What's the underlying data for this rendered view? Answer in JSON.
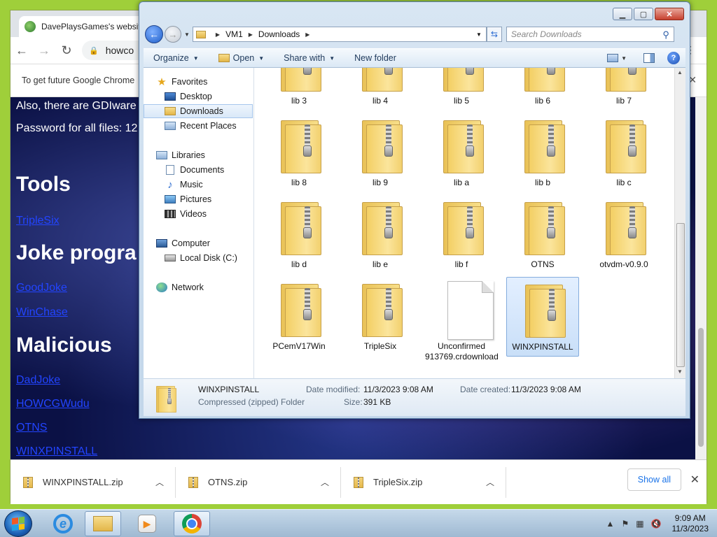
{
  "browser": {
    "tab_title": "DavePlaysGames's website",
    "url": "howco",
    "infobar_text": "To get future Google Chrome",
    "page": {
      "line1": "Also, there are GDIware",
      "password_line": "Password for all files: 12",
      "tools_heading": "Tools",
      "tools_link": "TripleSix",
      "joke_heading": "Joke progra",
      "joke_links": [
        "GoodJoke",
        "WinChase"
      ],
      "malicious_heading": "Malicious",
      "malicious_links": [
        "DadJoke",
        "HOWCGWudu",
        "OTNS",
        "WINXPINSTALL"
      ]
    },
    "downloads": [
      {
        "name": "WINXPINSTALL.zip"
      },
      {
        "name": "OTNS.zip"
      },
      {
        "name": "TripleSix.zip"
      }
    ],
    "show_all_label": "Show all"
  },
  "explorer": {
    "breadcrumb": [
      "VM1",
      "Downloads"
    ],
    "search_placeholder": "Search Downloads",
    "commands": {
      "organize": "Organize",
      "open": "Open",
      "share_with": "Share with",
      "new_folder": "New folder"
    },
    "nav": {
      "favorites": "Favorites",
      "desktop": "Desktop",
      "downloads": "Downloads",
      "recent_places": "Recent Places",
      "libraries": "Libraries",
      "documents": "Documents",
      "music": "Music",
      "pictures": "Pictures",
      "videos": "Videos",
      "computer": "Computer",
      "local_disk": "Local Disk (C:)",
      "network": "Network"
    },
    "files": [
      {
        "name": "lib 3",
        "type": "zip"
      },
      {
        "name": "lib 4",
        "type": "zip"
      },
      {
        "name": "lib 5",
        "type": "zip"
      },
      {
        "name": "lib 6",
        "type": "zip"
      },
      {
        "name": "lib 7",
        "type": "zip"
      },
      {
        "name": "lib 8",
        "type": "zip"
      },
      {
        "name": "lib 9",
        "type": "zip"
      },
      {
        "name": "lib a",
        "type": "zip"
      },
      {
        "name": "lib b",
        "type": "zip"
      },
      {
        "name": "lib c",
        "type": "zip"
      },
      {
        "name": "lib d",
        "type": "zip"
      },
      {
        "name": "lib e",
        "type": "zip"
      },
      {
        "name": "lib f",
        "type": "zip"
      },
      {
        "name": "OTNS",
        "type": "zip"
      },
      {
        "name": "otvdm-v0.9.0",
        "type": "zip"
      },
      {
        "name": "PCemV17Win",
        "type": "zip"
      },
      {
        "name": "TripleSix",
        "type": "zip"
      },
      {
        "name": "Unconfirmed 913769.crdownload",
        "type": "doc"
      },
      {
        "name": "WINXPINSTALL",
        "type": "zip",
        "selected": true
      }
    ],
    "details": {
      "name": "WINXPINSTALL",
      "type": "Compressed (zipped) Folder",
      "date_modified_label": "Date modified:",
      "date_modified": "11/3/2023 9:08 AM",
      "date_created_label": "Date created:",
      "date_created": "11/3/2023 9:08 AM",
      "size_label": "Size:",
      "size": "391 KB"
    }
  },
  "taskbar": {
    "time": "9:09 AM",
    "date": "11/3/2023"
  }
}
